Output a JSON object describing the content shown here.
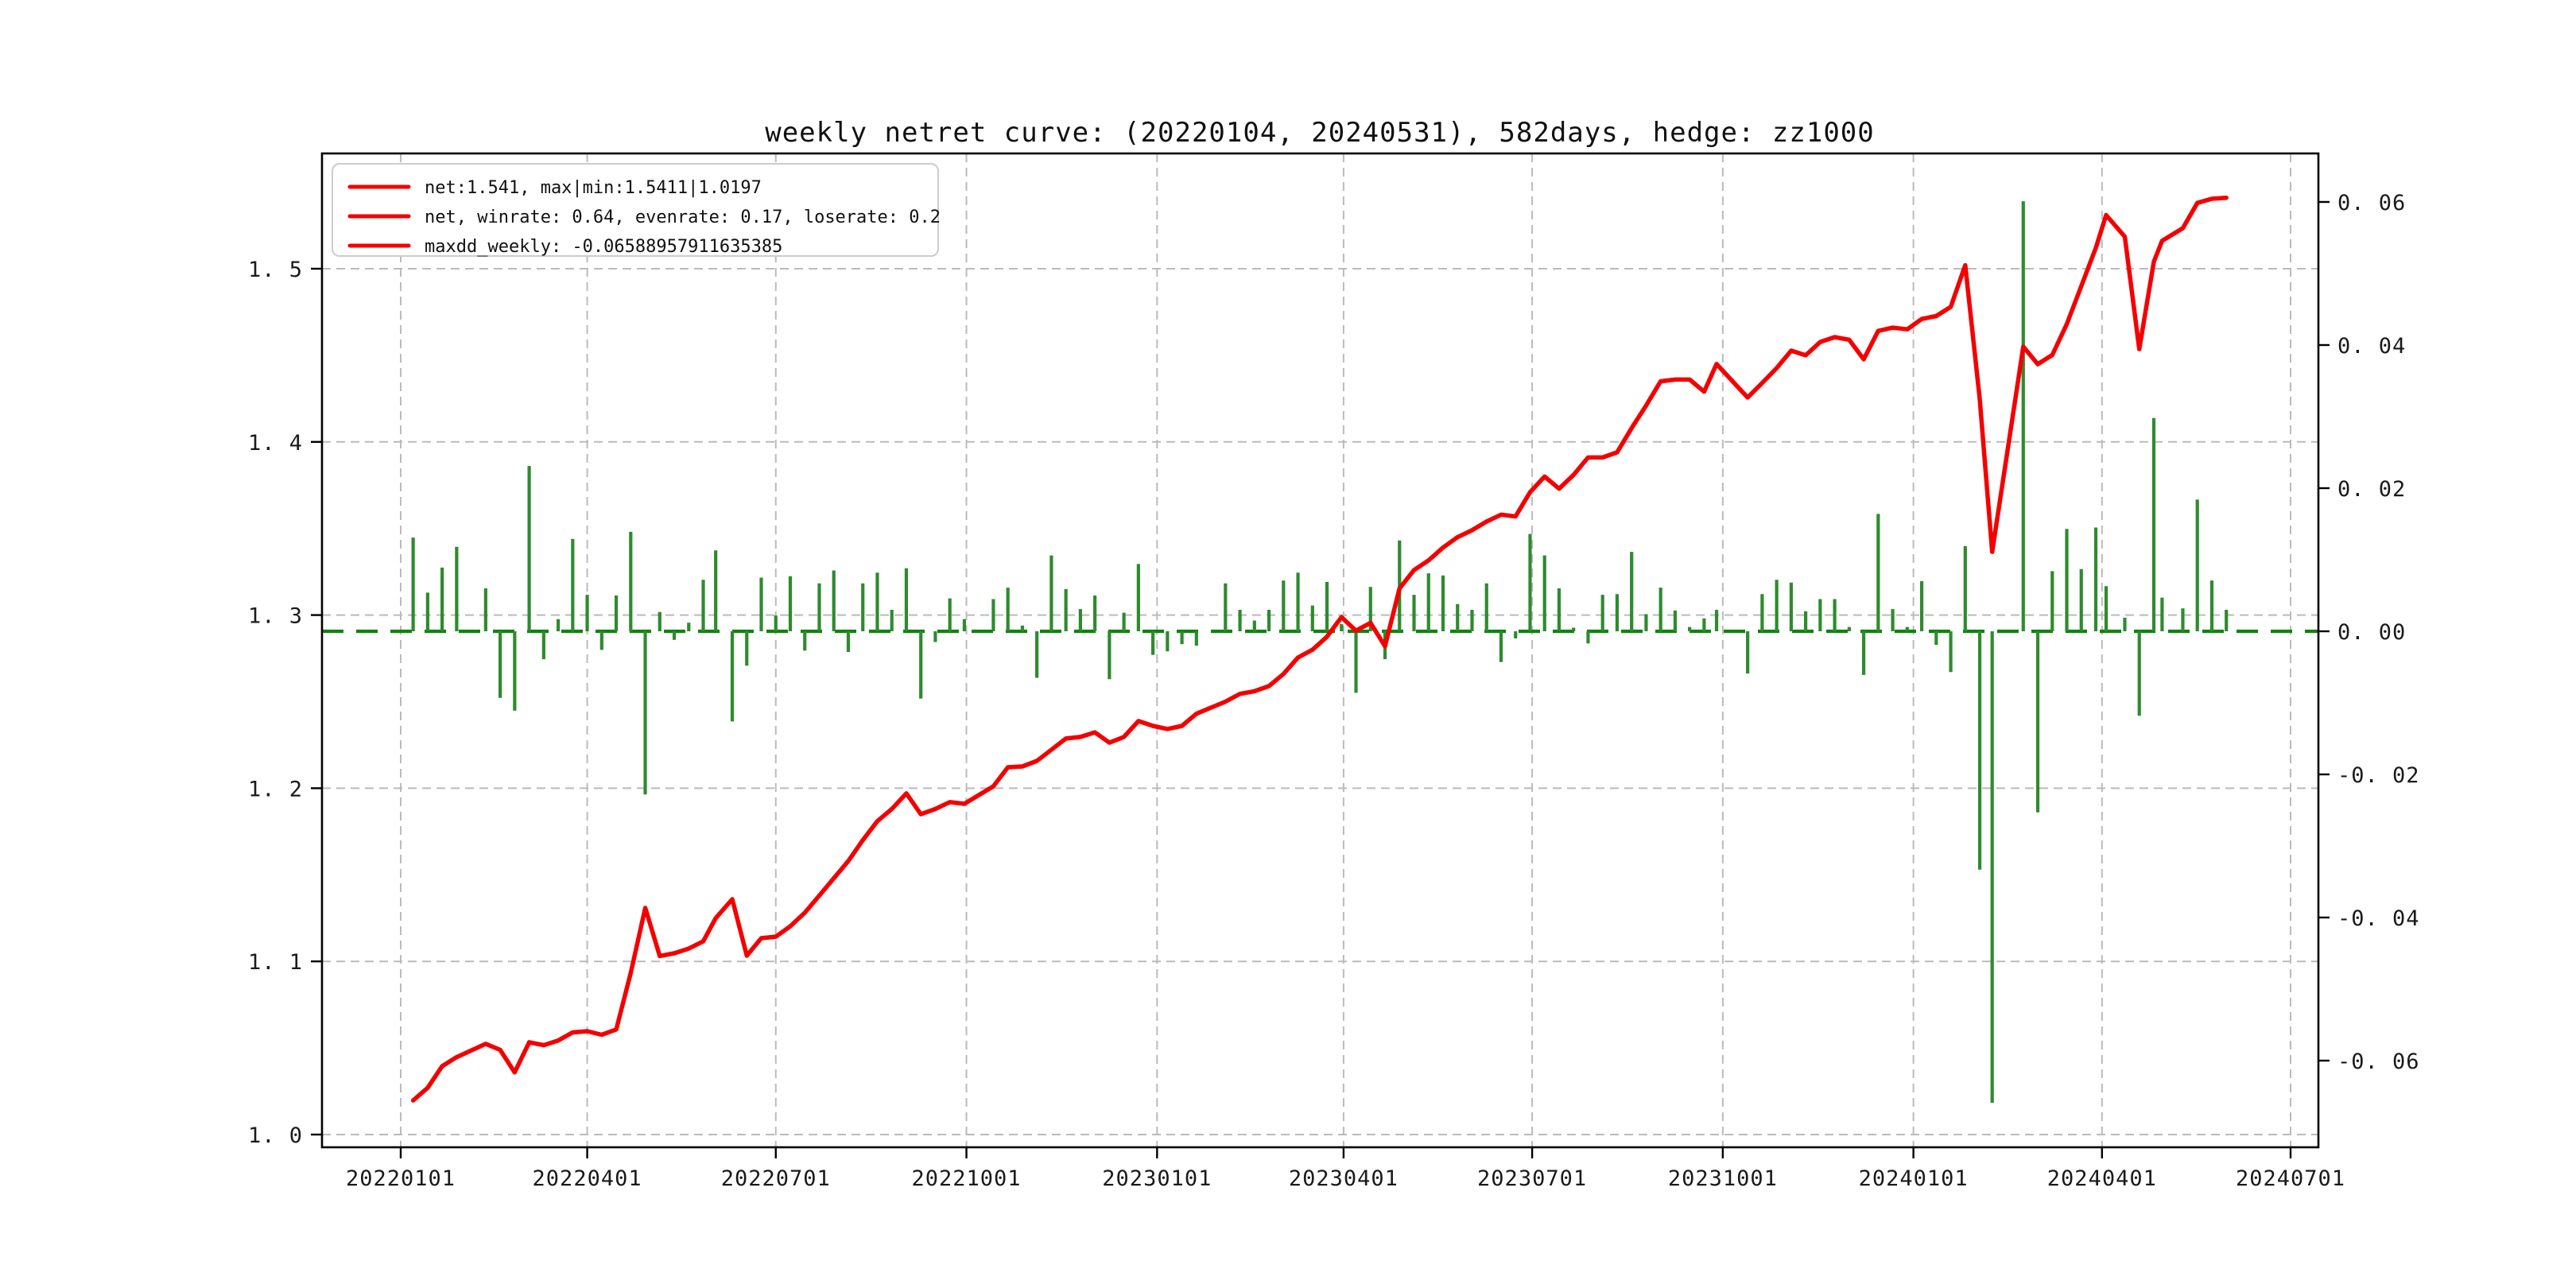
{
  "chart_data": {
    "type": "line",
    "title": "weekly netret curve: (20220104, 20240531), 582days, hedge: zz1000",
    "legend": {
      "position": "upper left",
      "items": [
        {
          "label": "net:1.541, max|min:1.5411|1.0197",
          "color": "#f40000"
        },
        {
          "label": "net, winrate: 0.64, evenrate: 0.17, loserate: 0.2",
          "color": "#f40000"
        },
        {
          "label": "maxdd_weekly: -0.06588957911635385",
          "color": "#f40000"
        }
      ]
    },
    "grid": true,
    "xlabel": "",
    "ylabel": "",
    "x_axis": {
      "ticks": [
        "20220101",
        "20220401",
        "20220701",
        "20221001",
        "20230101",
        "20230401",
        "20230701",
        "20231001",
        "20240101",
        "20240401",
        "20240701"
      ]
    },
    "y_left_axis": {
      "ticks": [
        {
          "label": "1. 0",
          "v": 1.0
        },
        {
          "label": "1. 1",
          "v": 1.1
        },
        {
          "label": "1. 2",
          "v": 1.2
        },
        {
          "label": "1. 3",
          "v": 1.3
        },
        {
          "label": "1. 4",
          "v": 1.4
        },
        {
          "label": "1. 5",
          "v": 1.5
        }
      ],
      "range": [
        0.993,
        1.567
      ]
    },
    "y_right_axis": {
      "ticks": [
        {
          "label": "0. 06",
          "v": 0.06
        },
        {
          "label": "0. 04",
          "v": 0.04
        },
        {
          "label": "0. 02",
          "v": 0.02
        },
        {
          "label": "0. 00",
          "v": 0.0
        },
        {
          "label": "-0. 02",
          "v": -0.02
        },
        {
          "label": "-0. 04",
          "v": -0.04
        },
        {
          "label": "-0. 06",
          "v": -0.06
        }
      ],
      "range": [
        -0.0722,
        0.0668
      ]
    },
    "series": [
      {
        "name": "net (cumulative, left axis)",
        "color": "#f40000",
        "type": "line"
      },
      {
        "name": "weekly return (bars, right axis)",
        "color": "#2e8b2e",
        "type": "bar"
      },
      {
        "name": "zero line (right axis)",
        "color": "#0e830e",
        "type": "dashed-hline",
        "v": 0
      }
    ],
    "points": [
      [
        "20220107",
        1.0197,
        0.0131
      ],
      [
        "20220114",
        1.027,
        0.0054
      ],
      [
        "20220121",
        1.0395,
        0.0089
      ],
      [
        "20220128",
        1.0447,
        0.0118
      ],
      [
        "20220211",
        1.0524,
        0.006
      ],
      [
        "20220218",
        1.0489,
        -0.0093
      ],
      [
        "20220225",
        1.0359,
        -0.0111
      ],
      [
        "20220304",
        1.0533,
        0.0231
      ],
      [
        "20220311",
        1.0516,
        -0.0039
      ],
      [
        "20220318",
        1.0543,
        0.0017
      ],
      [
        "20220325",
        1.059,
        0.0129
      ],
      [
        "20220401",
        1.0597,
        0.0051
      ],
      [
        "20220408",
        1.0576,
        -0.0026
      ],
      [
        "20220415",
        1.0607,
        0.005
      ],
      [
        "20220422",
        1.0933,
        0.0139
      ],
      [
        "20220429",
        1.1309,
        -0.0228
      ],
      [
        "20220506",
        1.1031,
        0.0027
      ],
      [
        "20220513",
        1.1047,
        -0.0012
      ],
      [
        "20220520",
        1.1074,
        0.0012
      ],
      [
        "20220527",
        1.1116,
        0.0072
      ],
      [
        "20220602",
        1.125,
        0.0113
      ],
      [
        "20220610",
        1.1359,
        -0.0126
      ],
      [
        "20220617",
        1.1033,
        -0.0048
      ],
      [
        "20220624",
        1.1134,
        0.0075
      ],
      [
        "20220701",
        1.1143,
        0.0022
      ],
      [
        "20220708",
        1.1203,
        0.0077
      ],
      [
        "20220715",
        1.1281,
        -0.0027
      ],
      [
        "20220722",
        1.138,
        0.0067
      ],
      [
        "20220729",
        1.148,
        0.0085
      ],
      [
        "20220805",
        1.158,
        -0.0029
      ],
      [
        "20220812",
        1.17,
        0.0067
      ],
      [
        "20220819",
        1.181,
        0.0082
      ],
      [
        "20220826",
        1.188,
        0.003
      ],
      [
        "20220902",
        1.197,
        0.0088
      ],
      [
        "20220909",
        1.185,
        -0.0094
      ],
      [
        "20220916",
        1.188,
        -0.0015
      ],
      [
        "20220923",
        1.192,
        0.0046
      ],
      [
        "20220930",
        1.191,
        0.0017
      ],
      [
        "20221014",
        1.2011,
        0.0045
      ],
      [
        "20221021",
        1.2121,
        0.0061
      ],
      [
        "20221028",
        1.2126,
        0.0008
      ],
      [
        "20221104",
        1.2158,
        -0.0065
      ],
      [
        "20221111",
        1.2222,
        0.0106
      ],
      [
        "20221118",
        1.2287,
        0.0059
      ],
      [
        "20221125",
        1.2296,
        0.0031
      ],
      [
        "20221202",
        1.2323,
        0.005
      ],
      [
        "20221209",
        1.2263,
        -0.0067
      ],
      [
        "20221216",
        1.2296,
        0.0026
      ],
      [
        "20221223",
        1.2388,
        0.0094
      ],
      [
        "20221230",
        1.236,
        -0.0033
      ],
      [
        "20230106",
        1.2342,
        -0.0028
      ],
      [
        "20230113",
        1.236,
        -0.0018
      ],
      [
        "20230120",
        1.243,
        -0.002
      ],
      [
        "20230203",
        1.25,
        0.0067
      ],
      [
        "20230210",
        1.2545,
        0.003
      ],
      [
        "20230217",
        1.256,
        0.0015
      ],
      [
        "20230224",
        1.259,
        0.003
      ],
      [
        "20230303",
        1.266,
        0.0071
      ],
      [
        "20230310",
        1.2755,
        0.0082
      ],
      [
        "20230317",
        1.28,
        0.0036
      ],
      [
        "20230324",
        1.2875,
        0.0069
      ],
      [
        "20230331",
        1.2988,
        0.001
      ],
      [
        "20230407",
        1.291,
        -0.0086
      ],
      [
        "20230414",
        1.2955,
        0.0062
      ],
      [
        "20230421",
        1.282,
        -0.0039
      ],
      [
        "20230428",
        1.3154,
        0.0127
      ],
      [
        "20230505",
        1.326,
        0.0051
      ],
      [
        "20230512",
        1.3316,
        0.0081
      ],
      [
        "20230519",
        1.339,
        0.0078
      ],
      [
        "20230526",
        1.345,
        0.0038
      ],
      [
        "20230602",
        1.349,
        0.003
      ],
      [
        "20230609",
        1.354,
        0.0067
      ],
      [
        "20230616",
        1.358,
        -0.0043
      ],
      [
        "20230623",
        1.357,
        -0.001
      ],
      [
        "20230630",
        1.371,
        0.0136
      ],
      [
        "20230707",
        1.38,
        0.0106
      ],
      [
        "20230714",
        1.373,
        0.006
      ],
      [
        "20230721",
        1.381,
        0.0005
      ],
      [
        "20230728",
        1.391,
        -0.0017
      ],
      [
        "20230804",
        1.391,
        0.0051
      ],
      [
        "20230811",
        1.394,
        0.0052
      ],
      [
        "20230818",
        1.408,
        0.0111
      ],
      [
        "20230825",
        1.421,
        0.0024
      ],
      [
        "20230901",
        1.435,
        0.0061
      ],
      [
        "20230908",
        1.436,
        0.0029
      ],
      [
        "20230915",
        1.436,
        0.0006
      ],
      [
        "20230922",
        1.429,
        0.0018
      ],
      [
        "20230928",
        1.445,
        0.003
      ],
      [
        "20231013",
        1.4256,
        -0.0059
      ],
      [
        "20231020",
        1.434,
        0.0052
      ],
      [
        "20231027",
        1.4426,
        0.0072
      ],
      [
        "20231103",
        1.4527,
        0.0068
      ],
      [
        "20231110",
        1.45,
        0.0028
      ],
      [
        "20231117",
        1.4577,
        0.0045
      ],
      [
        "20231124",
        1.4605,
        0.0045
      ],
      [
        "20231201",
        1.459,
        0.0006
      ],
      [
        "20231208",
        1.4477,
        -0.0061
      ],
      [
        "20231215",
        1.4641,
        0.0164
      ],
      [
        "20231222",
        1.466,
        0.0031
      ],
      [
        "20231229",
        1.465,
        0.0006
      ],
      [
        "20240105",
        1.471,
        0.007
      ],
      [
        "20240112",
        1.4727,
        -0.0019
      ],
      [
        "20240119",
        1.478,
        -0.0057
      ],
      [
        "20240126",
        1.502,
        0.0119
      ],
      [
        "20240202",
        1.425,
        -0.0333
      ],
      [
        "20240208",
        1.3365,
        -0.0659
      ],
      [
        "20240223",
        1.455,
        0.0601
      ],
      [
        "20240301",
        1.4449,
        -0.0253
      ],
      [
        "20240308",
        1.4502,
        0.0084
      ],
      [
        "20240315",
        1.468,
        0.0143
      ],
      [
        "20240322",
        1.49,
        0.0087
      ],
      [
        "20240329",
        1.512,
        0.0145
      ],
      [
        "20240403",
        1.531,
        0.0063
      ],
      [
        "20240412",
        1.5185,
        0.0019
      ],
      [
        "20240419",
        1.4536,
        -0.0118
      ],
      [
        "20240426",
        1.504,
        0.0298
      ],
      [
        "20240430",
        1.5161,
        0.0047
      ],
      [
        "20240510",
        1.5234,
        0.0032
      ],
      [
        "20240517",
        1.538,
        0.0184
      ],
      [
        "20240524",
        1.5404,
        0.0071
      ],
      [
        "20240531",
        1.541,
        0.003
      ]
    ]
  },
  "stats": {
    "net_final": "1.541",
    "net_max": "1.5411",
    "net_min": "1.0197",
    "winrate": "0.64",
    "evenrate": "0.17",
    "loserate": "0.2",
    "maxdd_weekly": "-0.06588957911635385",
    "period_start": "20220104",
    "period_end": "20240531",
    "days": "582",
    "hedge": "zz1000"
  },
  "colors": {
    "net_line": "#f40000",
    "bars": "#2e8b2e",
    "zero_line": "#0e830e",
    "grid": "#bbbbbb",
    "frame": "#000000",
    "background": "#ffffff"
  }
}
